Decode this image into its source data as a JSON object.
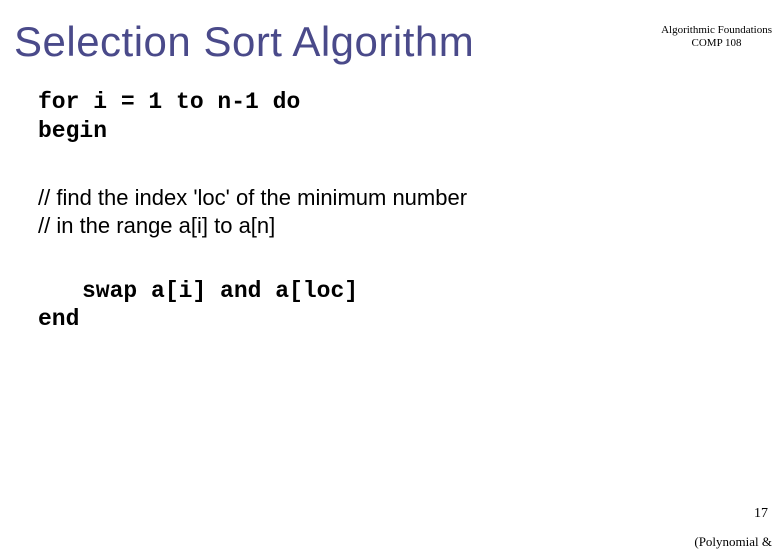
{
  "header": {
    "course_title": "Algorithmic Foundations",
    "course_code": "COMP 108"
  },
  "title": "Selection Sort Algorithm",
  "code": {
    "line1": "for i = 1 to n-1 do",
    "line2": "begin",
    "comment1": "// find the index 'loc' of the minimum number",
    "comment2": "// in the range a[i] to a[n]",
    "line3": "swap a[i] and a[loc]",
    "line4": "end"
  },
  "page_number": "17",
  "footer": "(Polynomial &"
}
